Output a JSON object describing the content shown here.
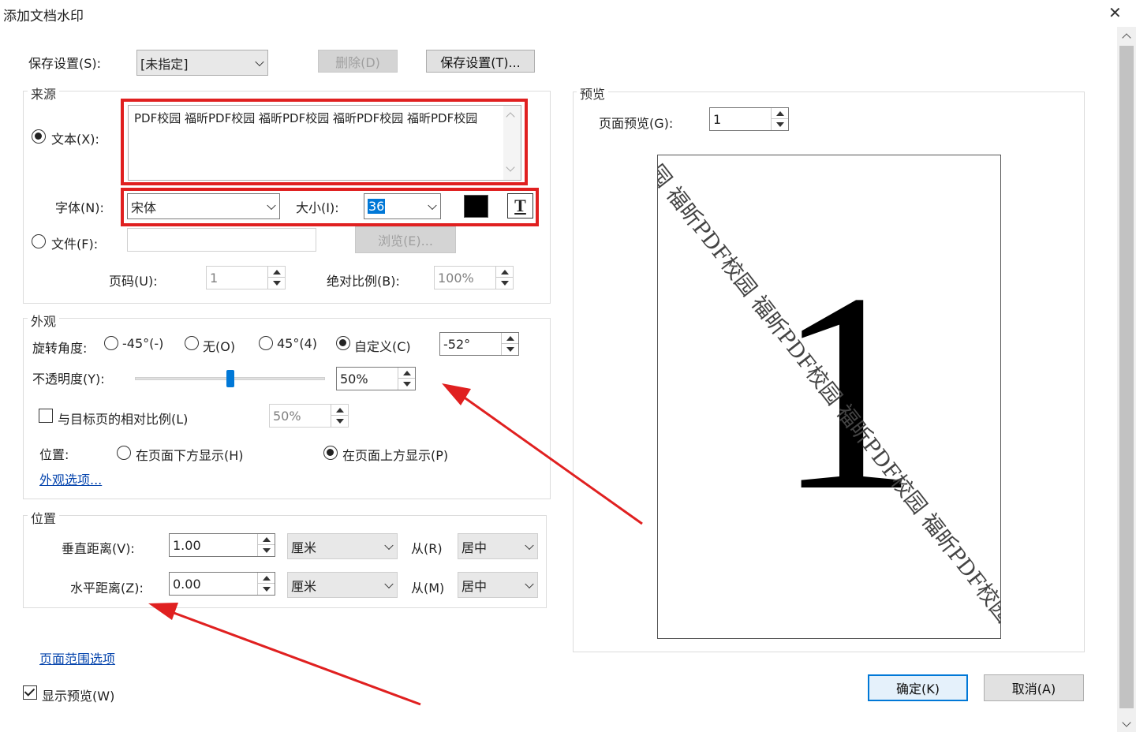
{
  "window": {
    "title": "添加文档水印",
    "close_glyph": "✕"
  },
  "saved_settings": {
    "label": "保存设置(S):",
    "value": "[未指定]",
    "delete_label": "删除(D)",
    "save_label": "保存设置(T)..."
  },
  "source": {
    "group_title": "来源",
    "text_radio_label": "文本(X):",
    "text_value": "PDF校园 福昕PDF校园 福昕PDF校园 福昕PDF校园 福昕PDF校园",
    "font_label": "字体(N):",
    "font_value": "宋体",
    "size_label": "大小(I):",
    "size_value": "36",
    "color": "#000000",
    "text_style_glyph": "T",
    "file_radio_label": "文件(F):",
    "browse_label": "浏览(E)...",
    "page_label": "页码(U):",
    "page_value": "1",
    "scale_label": "绝对比例(B):",
    "scale_value": "100%"
  },
  "appearance": {
    "group_title": "外观",
    "rotation_label": "旋转角度:",
    "rot_neg45": "-45°(-)",
    "rot_none": "无(O)",
    "rot_45": "45°(4)",
    "rot_custom": "自定义(C)",
    "rot_custom_value": "-52°",
    "opacity_label": "不透明度(Y):",
    "opacity_value": "50%",
    "opacity_fraction": 0.5,
    "relative_scale_label": "与目标页的相对比例(L)",
    "relative_scale_value": "50%",
    "position_label": "位置:",
    "below_page": "在页面下方显示(H)",
    "above_page": "在页面上方显示(P)",
    "options_link": "外观选项..."
  },
  "position": {
    "group_title": "位置",
    "vertical_label": "垂直距离(V):",
    "vertical_value": "1.00",
    "vertical_unit": "厘米",
    "vertical_from_label": "从(R)",
    "vertical_from_value": "居中",
    "horizontal_label": "水平距离(Z):",
    "horizontal_value": "0.00",
    "horizontal_unit": "厘米",
    "horizontal_from_label": "从(M)",
    "horizontal_from_value": "居中"
  },
  "page_range_link": "页面范围选项",
  "show_preview_label": "显示预览(W)",
  "preview": {
    "group_title": "预览",
    "page_preview_label": "页面预览(G):",
    "page_preview_value": "1",
    "page_number_shown": "1",
    "watermark_text": "园 福昕PDF校园 福昕PDF校园 福昕PDF校园 福昕PDF校园 福昕"
  },
  "ok_label": "确定(K)",
  "cancel_label": "取消(A)",
  "colors": {
    "annotation_red": "#e02020",
    "link": "#0645ad",
    "accent": "#0078d7"
  }
}
